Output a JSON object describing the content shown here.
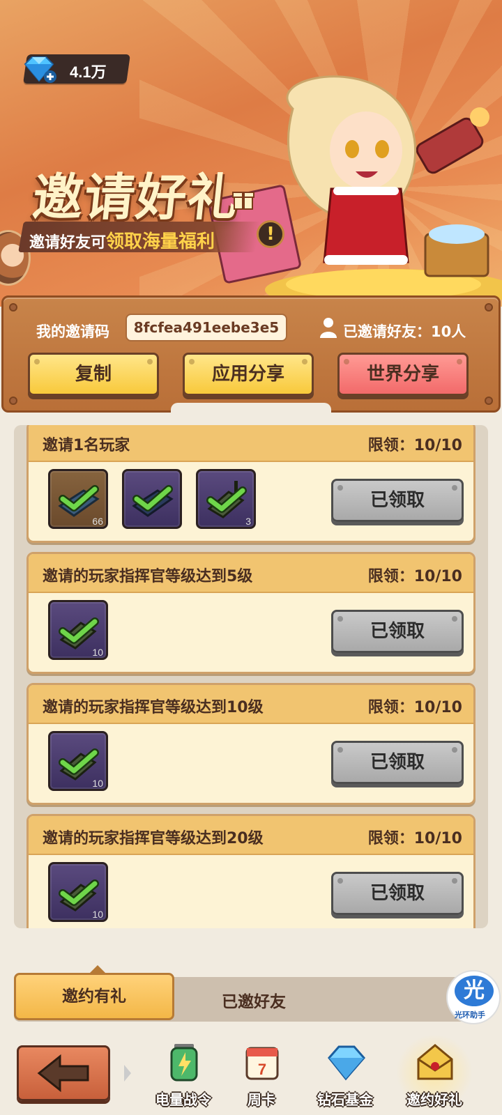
{
  "currency": {
    "value": "4.1万",
    "icon": "diamond-plus-icon"
  },
  "banner": {
    "title": "邀请好礼",
    "subtitle_prefix": "邀请好友可",
    "subtitle_highlight": "领取海量福利",
    "exclaim": "!"
  },
  "invite": {
    "code_label": "我的邀请码",
    "code": "8fcfea491eebe3e5",
    "invited_label": "已邀请好友：10人"
  },
  "actions": {
    "copy": "复制",
    "app_share": "应用分享",
    "world_share": "世界分享"
  },
  "tasks": [
    {
      "title": "邀请1名玩家",
      "limit": "限领：10/10",
      "button": "已领取",
      "items": [
        {
          "count": "66",
          "name": "bag-reward-icon"
        },
        {
          "count": "",
          "name": "bag-reward-icon"
        },
        {
          "count": "3",
          "name": "phone-reward-icon"
        }
      ]
    },
    {
      "title": "邀请的玩家指挥官等级达到5级",
      "limit": "限领：10/10",
      "button": "已领取",
      "items": [
        {
          "count": "10",
          "name": "phone-reward-icon"
        }
      ]
    },
    {
      "title": "邀请的玩家指挥官等级达到10级",
      "limit": "限领：10/10",
      "button": "已领取",
      "items": [
        {
          "count": "10",
          "name": "phone-reward-icon"
        }
      ]
    },
    {
      "title": "邀请的玩家指挥官等级达到20级",
      "limit": "限领：10/10",
      "button": "已领取",
      "items": [
        {
          "count": "10",
          "name": "phone-reward-icon"
        }
      ]
    }
  ],
  "tabs": {
    "active": "邀约有礼",
    "inactive": "已邀好友"
  },
  "helper": {
    "badge": "光",
    "label": "光环助手"
  },
  "nav": [
    {
      "label": "电量战令",
      "icon": "battery-icon"
    },
    {
      "label": "周卡",
      "icon": "calendar-icon",
      "badge": "7"
    },
    {
      "label": "钻石基金",
      "icon": "diamond-icon"
    },
    {
      "label": "邀约好礼",
      "icon": "envelope-icon"
    }
  ],
  "colors": {
    "accent": "#f8c93b",
    "danger": "#f26a6a",
    "claimed": "#a9a9a9",
    "header": "#f1c470"
  }
}
